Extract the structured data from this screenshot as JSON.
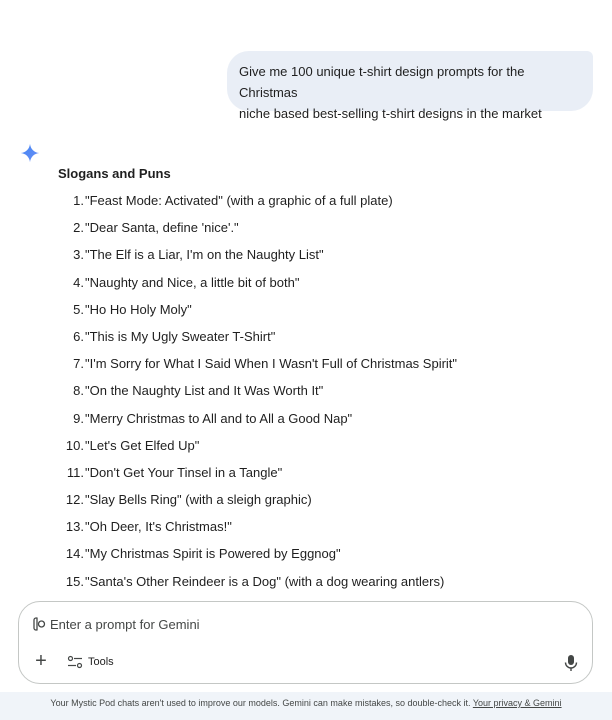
{
  "user_message": {
    "line1": "Give me 100 unique t-shirt design prompts for the Christmas",
    "line2": "niche based best-selling t-shirt designs in the market"
  },
  "response": {
    "section_title": "Slogans and Puns",
    "items": [
      {
        "num": "1.",
        "text": "\"Feast Mode: Activated\" (with a graphic of a full plate)"
      },
      {
        "num": "2.",
        "text": "\"Dear Santa, define 'nice'.\""
      },
      {
        "num": "3.",
        "text": "\"The Elf is a Liar, I'm on the Naughty List\""
      },
      {
        "num": "4.",
        "text": "\"Naughty and Nice, a little bit of both\""
      },
      {
        "num": "5.",
        "text": "\"Ho Ho Holy Moly\""
      },
      {
        "num": "6.",
        "text": "\"This is My Ugly Sweater T-Shirt\""
      },
      {
        "num": "7.",
        "text": "\"I'm Sorry for What I Said When I Wasn't Full of Christmas Spirit\""
      },
      {
        "num": "8.",
        "text": "\"On the Naughty List and It Was Worth It\""
      },
      {
        "num": "9.",
        "text": "\"Merry Christmas to All and to All a Good Nap\""
      },
      {
        "num": "10.",
        "text": "\"Let's Get Elfed Up\""
      },
      {
        "num": "11.",
        "text": "\"Don't Get Your Tinsel in a Tangle\""
      },
      {
        "num": "12.",
        "text": "\"Slay Bells Ring\" (with a sleigh graphic)"
      },
      {
        "num": "13.",
        "text": "\"Oh Deer, It's Christmas!\""
      },
      {
        "num": "14.",
        "text": "\"My Christmas Spirit is Powered by Eggnog\""
      },
      {
        "num": "15.",
        "text": "\"Santa's Other Reindeer is a Dog\" (with a dog wearing antlers)"
      }
    ]
  },
  "input": {
    "placeholder": "Enter a prompt for Gemini",
    "plus_label": "+",
    "tools_label": "Tools"
  },
  "footer": {
    "text": "Your Mystic Pod chats aren't used to improve our models. Gemini can make mistakes, so double-check it. ",
    "link": "Your privacy & Gemini"
  },
  "icons": {
    "gemini": "gemini-sparkle-icon",
    "cursor": "text-cursor-icon",
    "tools": "tools-sliders-icon",
    "mic": "microphone-icon"
  },
  "colors": {
    "user_bubble_bg": "#e9eef6",
    "gemini_blue": "#4285f4",
    "footer_bg": "#f0f4f9",
    "text": "#1f1f1f"
  }
}
